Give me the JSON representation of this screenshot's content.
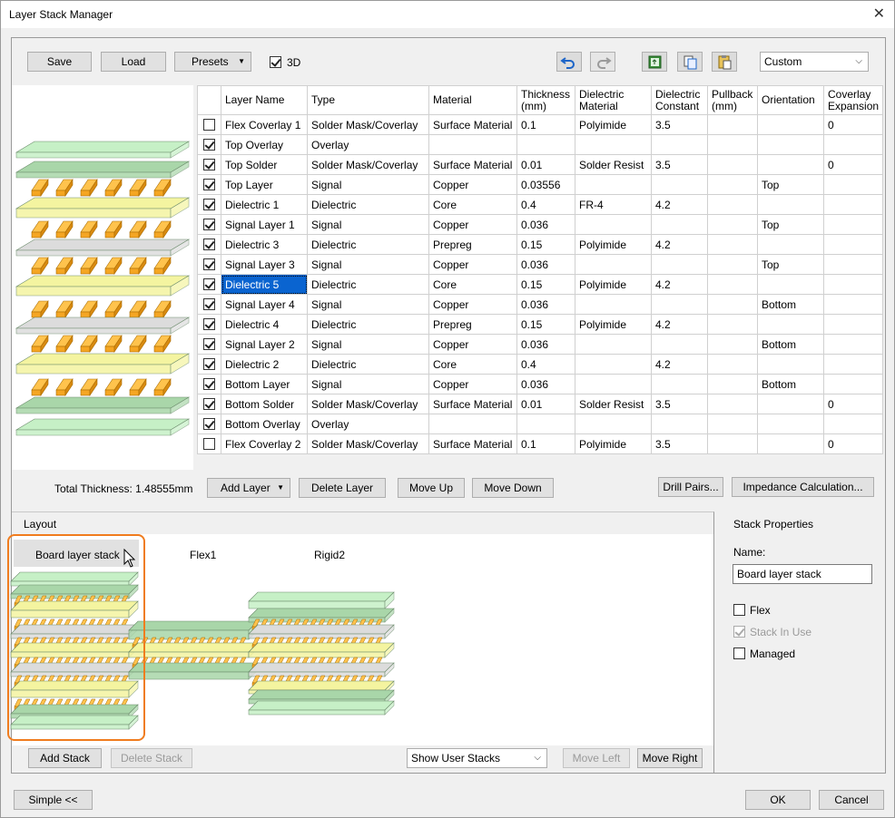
{
  "window": {
    "title": "Layer Stack Manager",
    "close_glyph": "✕"
  },
  "toolbar": {
    "save": "Save",
    "load": "Load",
    "presets": "Presets",
    "threeD_label": "3D",
    "threeD_checked": true,
    "mode_select": "Custom"
  },
  "table": {
    "headers": [
      "Layer Name",
      "Type",
      "Material",
      "Thickness (mm)",
      "Dielectric Material",
      "Dielectric Constant",
      "Pullback (mm)",
      "Orientation",
      "Coverlay Expansion"
    ],
    "rows": [
      {
        "checked": false,
        "name": "Flex Coverlay 1",
        "type": "Solder Mask/Coverlay",
        "material": "Surface Material",
        "thickness": "0.1",
        "diel_mat": "Polyimide",
        "diel_const": "3.5",
        "pullback": "",
        "orientation": "",
        "coverlay": "0"
      },
      {
        "checked": true,
        "name": "Top Overlay",
        "type": "Overlay",
        "material": "",
        "thickness": "",
        "diel_mat": "",
        "diel_const": "",
        "pullback": "",
        "orientation": "",
        "coverlay": ""
      },
      {
        "checked": true,
        "name": "Top Solder",
        "type": "Solder Mask/Coverlay",
        "material": "Surface Material",
        "thickness": "0.01",
        "diel_mat": "Solder Resist",
        "diel_const": "3.5",
        "pullback": "",
        "orientation": "",
        "coverlay": "0"
      },
      {
        "checked": true,
        "name": "Top Layer",
        "type": "Signal",
        "material": "Copper",
        "thickness": "0.03556",
        "diel_mat": "",
        "diel_const": "",
        "pullback": "",
        "orientation": "Top",
        "coverlay": ""
      },
      {
        "checked": true,
        "name": "Dielectric 1",
        "type": "Dielectric",
        "material": "Core",
        "thickness": "0.4",
        "diel_mat": "FR-4",
        "diel_const": "4.2",
        "pullback": "",
        "orientation": "",
        "coverlay": ""
      },
      {
        "checked": true,
        "name": "Signal Layer 1",
        "type": "Signal",
        "material": "Copper",
        "thickness": "0.036",
        "diel_mat": "",
        "diel_const": "",
        "pullback": "",
        "orientation": "Top",
        "coverlay": ""
      },
      {
        "checked": true,
        "name": "Dielectric 3",
        "type": "Dielectric",
        "material": "Prepreg",
        "thickness": "0.15",
        "diel_mat": "Polyimide",
        "diel_const": "4.2",
        "pullback": "",
        "orientation": "",
        "coverlay": ""
      },
      {
        "checked": true,
        "name": "Signal Layer 3",
        "type": "Signal",
        "material": "Copper",
        "thickness": "0.036",
        "diel_mat": "",
        "diel_const": "",
        "pullback": "",
        "orientation": "Top",
        "coverlay": ""
      },
      {
        "checked": true,
        "name": "Dielectric 5",
        "type": "Dielectric",
        "material": "Core",
        "thickness": "0.15",
        "diel_mat": "Polyimide",
        "diel_const": "4.2",
        "pullback": "",
        "orientation": "",
        "coverlay": "",
        "selected": true
      },
      {
        "checked": true,
        "name": "Signal Layer 4",
        "type": "Signal",
        "material": "Copper",
        "thickness": "0.036",
        "diel_mat": "",
        "diel_const": "",
        "pullback": "",
        "orientation": "Bottom",
        "coverlay": ""
      },
      {
        "checked": true,
        "name": "Dielectric 4",
        "type": "Dielectric",
        "material": "Prepreg",
        "thickness": "0.15",
        "diel_mat": "Polyimide",
        "diel_const": "4.2",
        "pullback": "",
        "orientation": "",
        "coverlay": ""
      },
      {
        "checked": true,
        "name": "Signal Layer 2",
        "type": "Signal",
        "material": "Copper",
        "thickness": "0.036",
        "diel_mat": "",
        "diel_const": "",
        "pullback": "",
        "orientation": "Bottom",
        "coverlay": ""
      },
      {
        "checked": true,
        "name": "Dielectric 2",
        "type": "Dielectric",
        "material": "Core",
        "thickness": "0.4",
        "diel_mat": "",
        "diel_const": "4.2",
        "pullback": "",
        "orientation": "",
        "coverlay": ""
      },
      {
        "checked": true,
        "name": "Bottom Layer",
        "type": "Signal",
        "material": "Copper",
        "thickness": "0.036",
        "diel_mat": "",
        "diel_const": "",
        "pullback": "",
        "orientation": "Bottom",
        "coverlay": ""
      },
      {
        "checked": true,
        "name": "Bottom Solder",
        "type": "Solder Mask/Coverlay",
        "material": "Surface Material",
        "thickness": "0.01",
        "diel_mat": "Solder Resist",
        "diel_const": "3.5",
        "pullback": "",
        "orientation": "",
        "coverlay": "0"
      },
      {
        "checked": true,
        "name": "Bottom Overlay",
        "type": "Overlay",
        "material": "",
        "thickness": "",
        "diel_mat": "",
        "diel_const": "",
        "pullback": "",
        "orientation": "",
        "coverlay": ""
      },
      {
        "checked": false,
        "name": "Flex Coverlay 2",
        "type": "Solder Mask/Coverlay",
        "material": "Surface Material",
        "thickness": "0.1",
        "diel_mat": "Polyimide",
        "diel_const": "3.5",
        "pullback": "",
        "orientation": "",
        "coverlay": "0"
      }
    ]
  },
  "actions": {
    "total_thickness": "Total Thickness: 1.48555mm",
    "add_layer": "Add Layer",
    "delete_layer": "Delete Layer",
    "move_up": "Move Up",
    "move_down": "Move Down",
    "drill_pairs": "Drill Pairs...",
    "impedance": "Impedance Calculation..."
  },
  "layout": {
    "header": "Layout",
    "stacks": [
      "Board layer stack",
      "Flex1",
      "Rigid2"
    ],
    "add_stack": "Add Stack",
    "delete_stack": "Delete Stack",
    "show_select": "Show User Stacks",
    "move_left": "Move Left",
    "move_right": "Move Right"
  },
  "stack_props": {
    "header": "Stack Properties",
    "name_label": "Name:",
    "name_value": "Board layer stack",
    "flex": "Flex",
    "stack_in_use": "Stack In Use",
    "managed": "Managed"
  },
  "footer": {
    "simple": "Simple <<",
    "ok": "OK",
    "cancel": "Cancel"
  },
  "colors": {
    "selection": "#0a64d0",
    "copper": "#f5a623",
    "soldermask": "#a9d6a9",
    "overlay": "#c6f0c6",
    "core": "#f4f4a0",
    "prepreg": "#dcdcdc",
    "highlight": "#f07c1e"
  }
}
